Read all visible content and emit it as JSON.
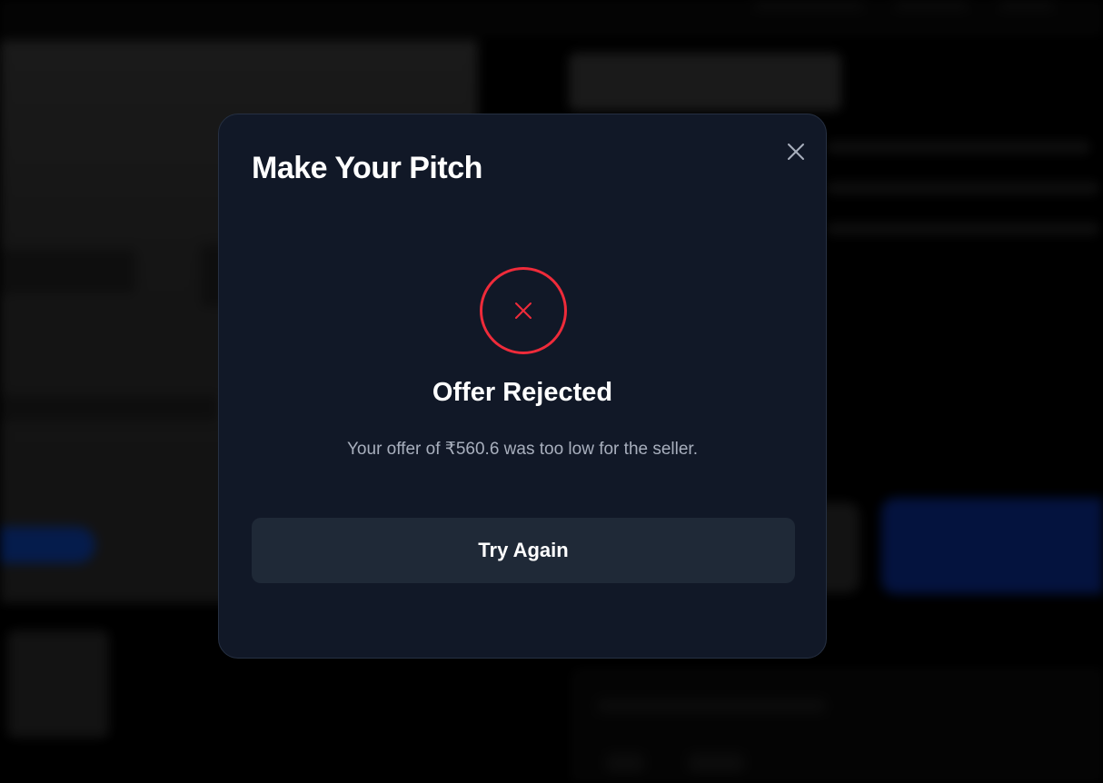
{
  "modal": {
    "title": "Make Your Pitch",
    "close_icon": "close-icon",
    "status_icon": "x-icon",
    "status_heading": "Offer Rejected",
    "status_message": "Your offer of ₹560.6 was too low for the seller.",
    "action_label": "Try Again"
  },
  "colors": {
    "modal_background": "#111827",
    "button_background": "#1f2937",
    "error_red": "#ef2b3a",
    "muted_text": "#a8afbd"
  }
}
